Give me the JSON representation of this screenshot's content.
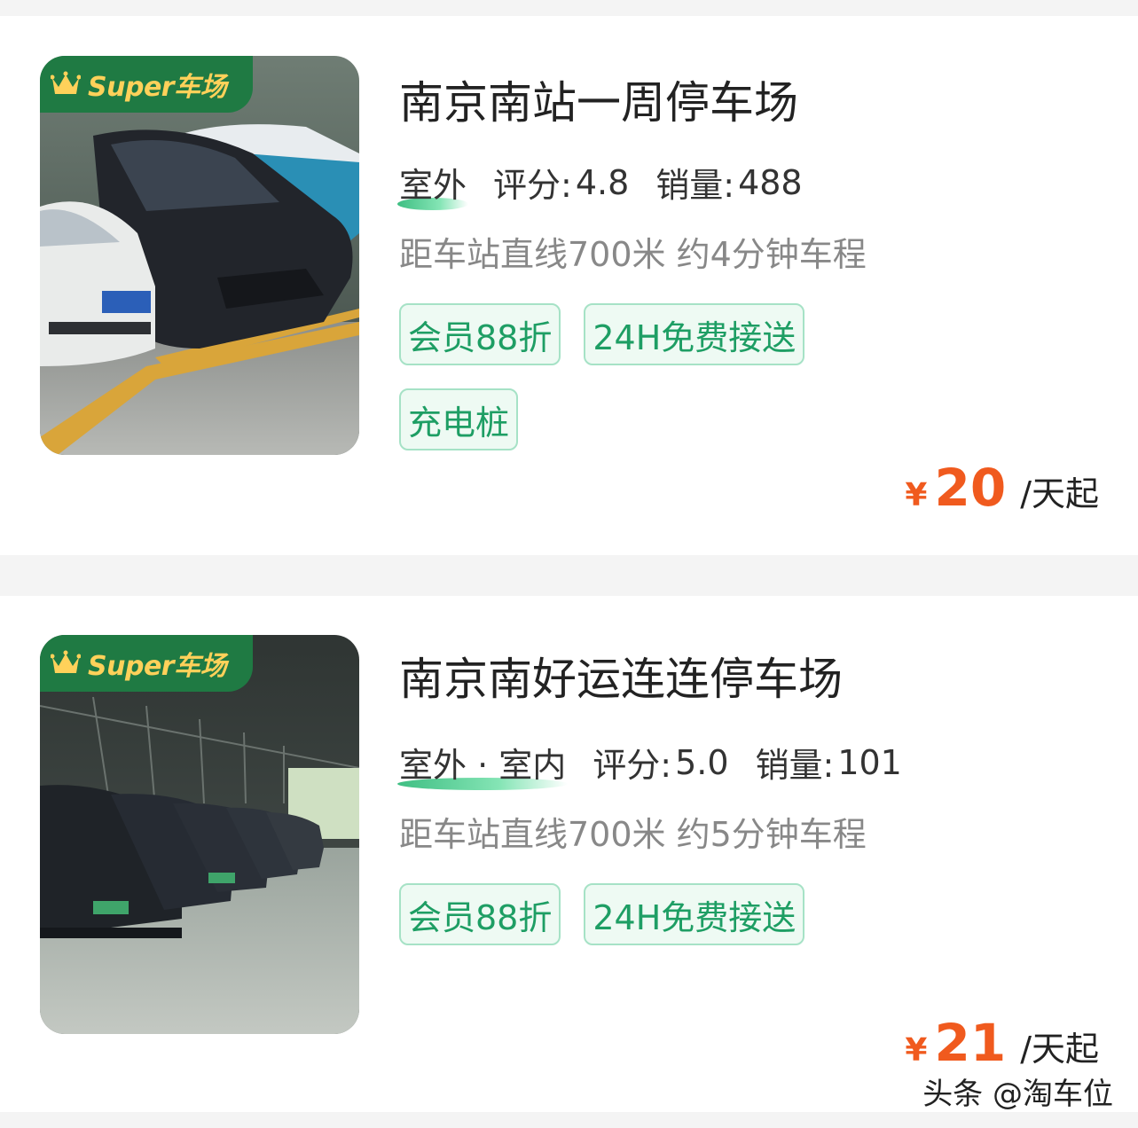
{
  "listings": [
    {
      "badge": "Super车场",
      "name": "南京南站一周停车场",
      "environment": "室外",
      "rating_label": "评分:",
      "rating": "4.8",
      "sales_label": "销量:",
      "sales": "488",
      "distance": "距车站直线700米 约4分钟车程",
      "tags": [
        "会员88折",
        "24H免费接送",
        "充电桩"
      ],
      "currency": "¥",
      "price": "20",
      "price_unit": "/天起"
    },
    {
      "badge": "Super车场",
      "name": "南京南好运连连停车场",
      "environment": "室外 · 室内",
      "rating_label": "评分:",
      "rating": "5.0",
      "sales_label": "销量:",
      "sales": "101",
      "distance": "距车站直线700米 约5分钟车程",
      "tags": [
        "会员88折",
        "24H免费接送"
      ],
      "currency": "¥",
      "price": "21",
      "price_unit": "/天起"
    }
  ],
  "watermark": "头条 @淘车位",
  "colors": {
    "accent_green": "#1e9e64",
    "badge_green": "#1f7a43",
    "badge_text": "#ffd15a",
    "price_orange": "#f05a1e",
    "background": "#f4f4f4"
  },
  "icons": {
    "badge_icon": "crown-icon"
  }
}
